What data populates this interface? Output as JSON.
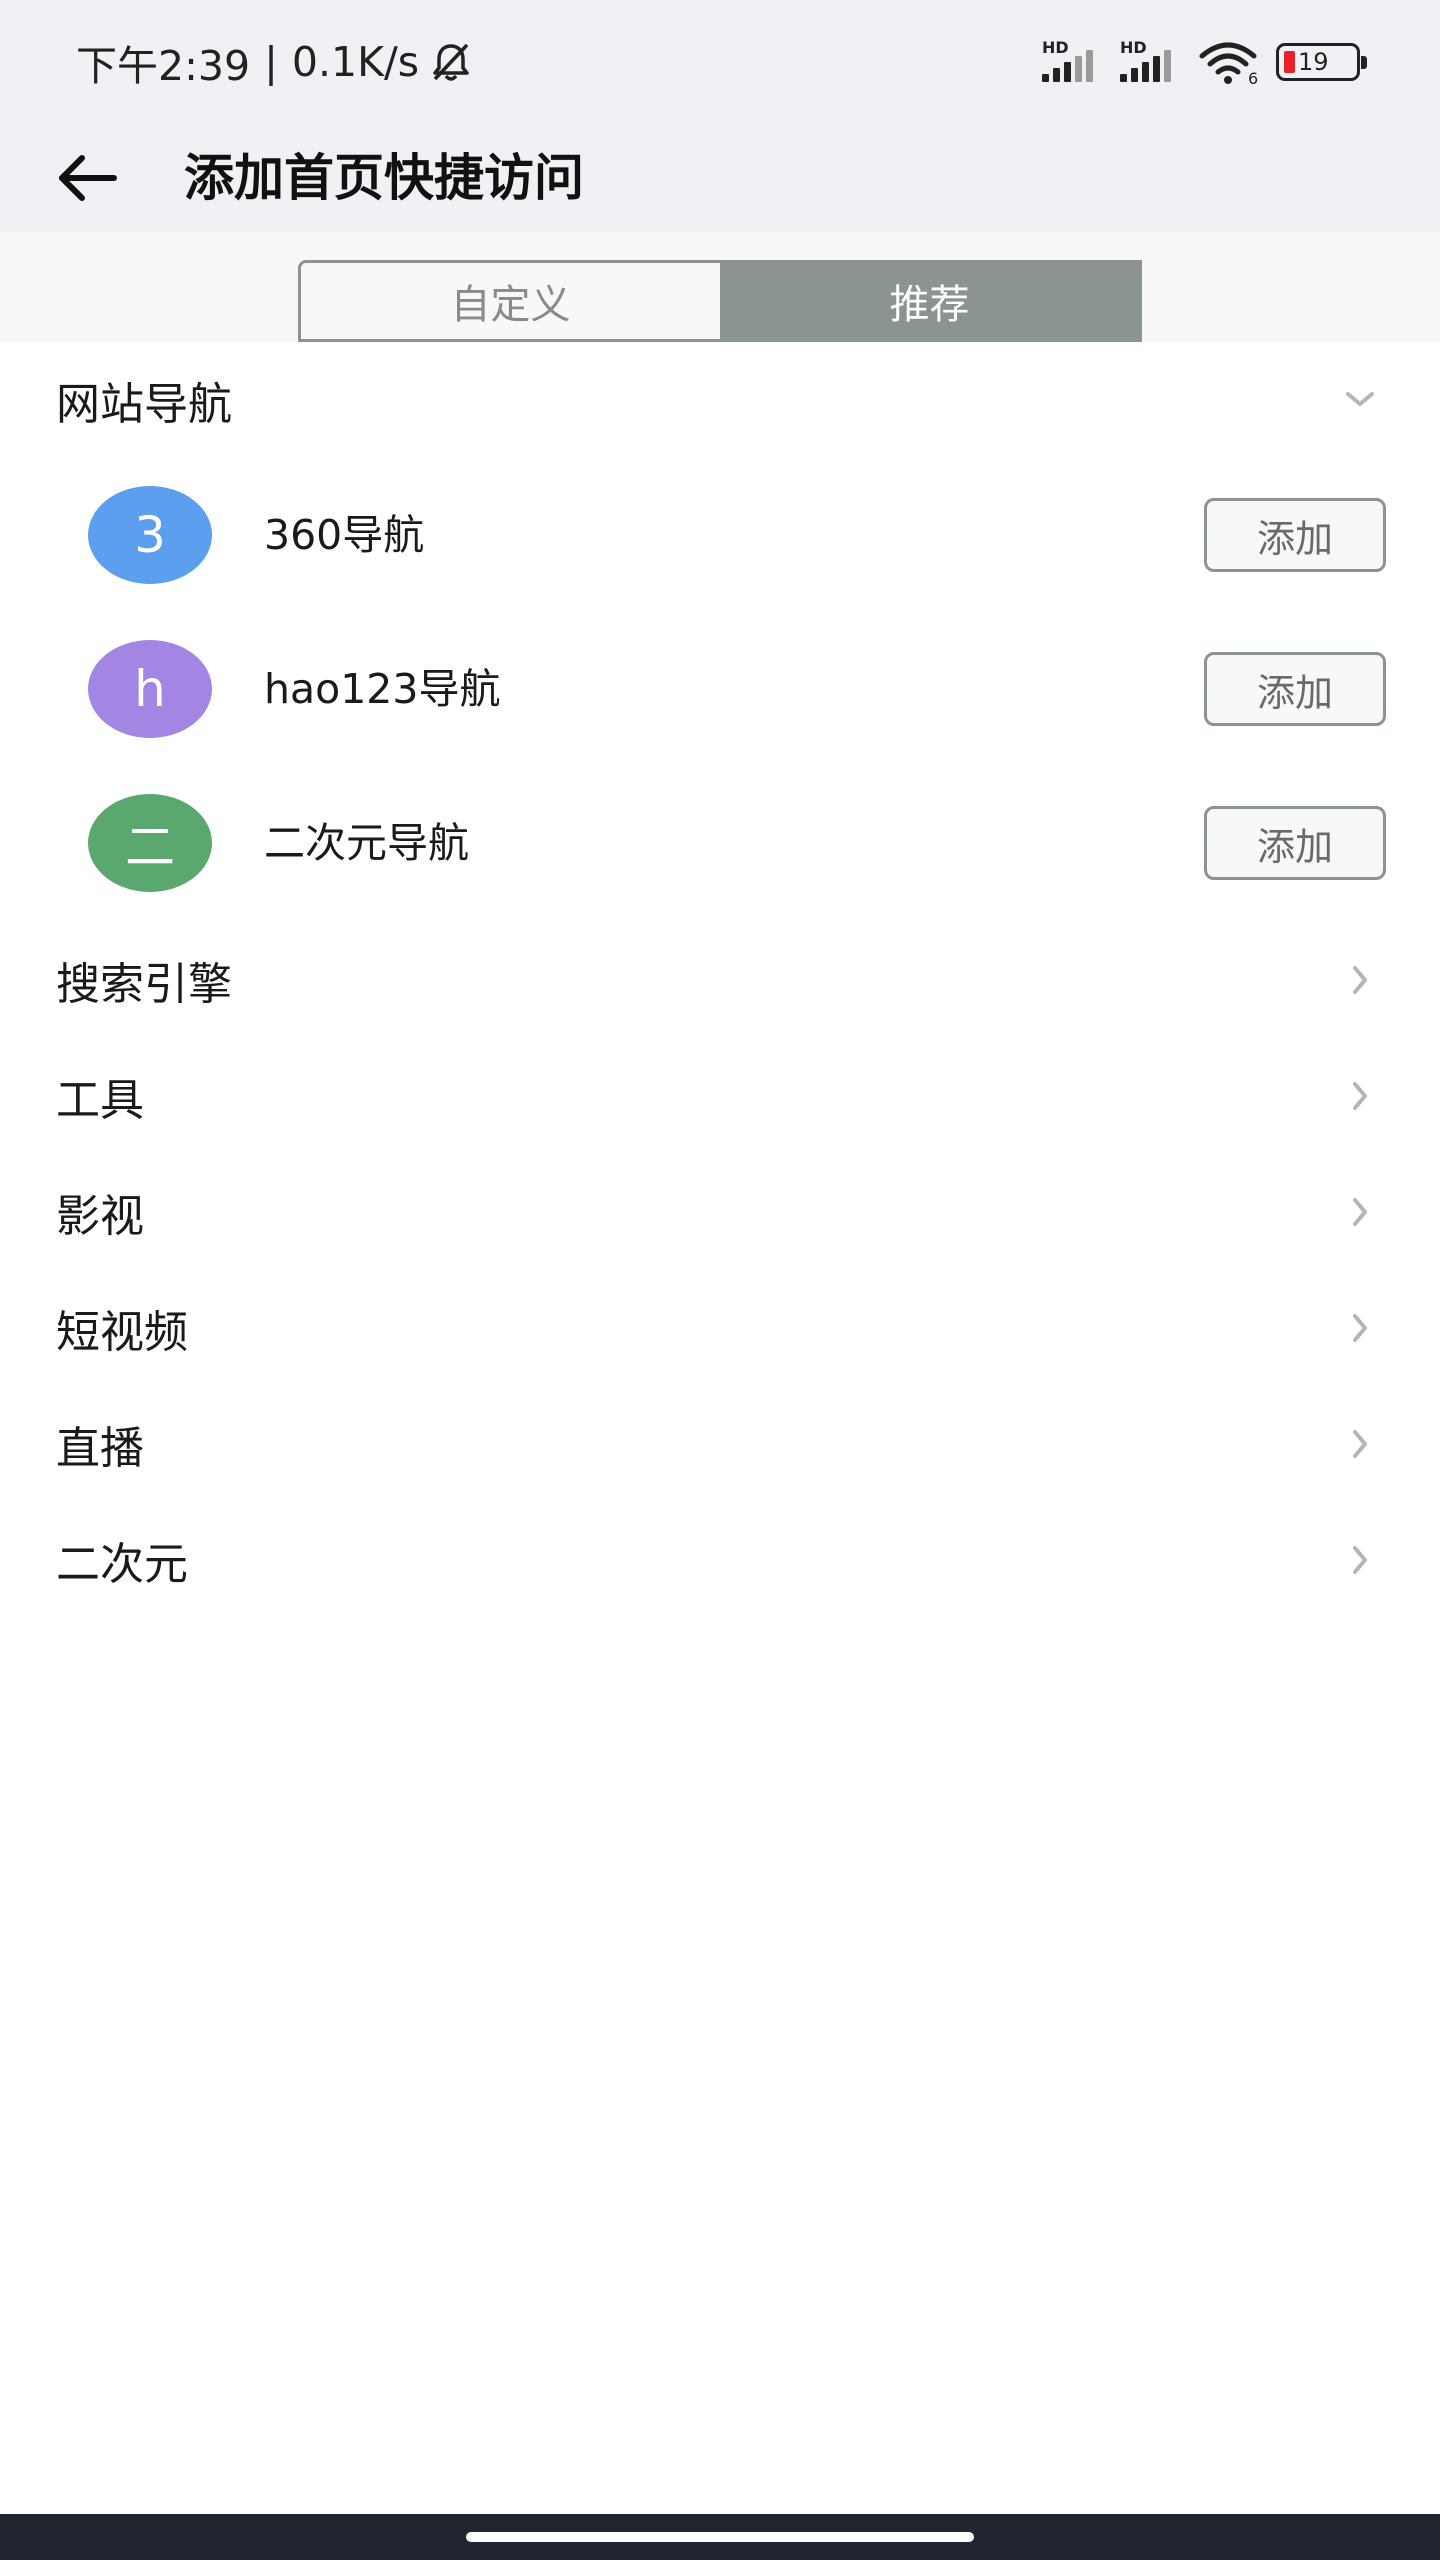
{
  "status_bar": {
    "time": "下午2:39",
    "separator": "|",
    "speed": "0.1K/s",
    "signal_1_label": "HD",
    "signal_2_label": "HD",
    "wifi_badge": "6",
    "battery_level": "19",
    "battery_color": "#e8212b"
  },
  "header": {
    "title": "添加首页快捷访问"
  },
  "tabs": [
    {
      "label": "自定义",
      "active": false
    },
    {
      "label": "推荐",
      "active": true
    }
  ],
  "sections": {
    "website_nav": {
      "label": "网站导航",
      "expanded": true,
      "items": [
        {
          "avatar_letter": "3",
          "avatar_color": "#5b9fee",
          "name": "360导航",
          "button": "添加"
        },
        {
          "avatar_letter": "h",
          "avatar_color": "#a385e3",
          "name": "hao123导航",
          "button": "添加"
        },
        {
          "avatar_letter": "二",
          "avatar_color": "#5aa86f",
          "name": "二次元导航",
          "button": "添加"
        }
      ]
    },
    "search_engine": {
      "label": "搜索引擎"
    },
    "tools": {
      "label": "工具"
    },
    "film": {
      "label": "影视"
    },
    "short_video": {
      "label": "短视频"
    },
    "live": {
      "label": "直播"
    },
    "anime": {
      "label": "二次元"
    }
  },
  "colors": {
    "accent_gray": "#8c9493",
    "header_bg": "#eff1f5"
  }
}
